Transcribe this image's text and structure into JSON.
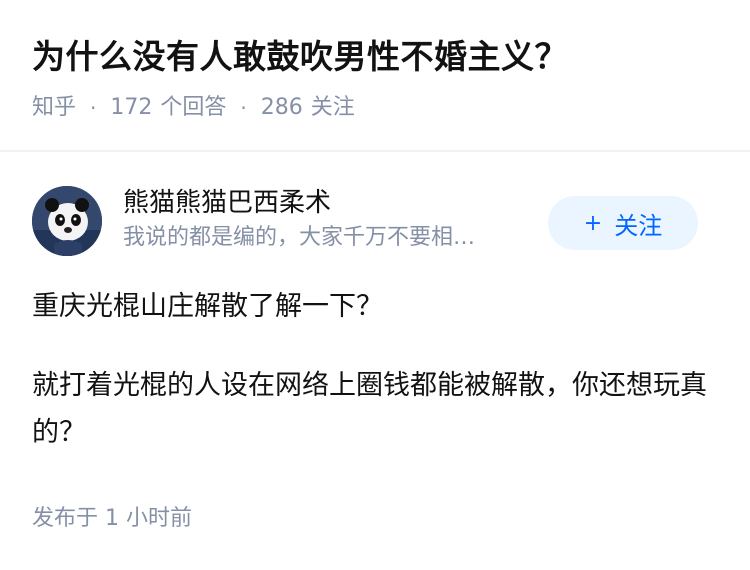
{
  "question": {
    "title": "为什么没有人敢鼓吹男性不婚主义？",
    "source": "知乎",
    "answer_count": "172",
    "answer_label": "个回答",
    "follower_count": "286",
    "follower_label": "关注"
  },
  "author": {
    "name": "熊猫熊猫巴西柔术",
    "bio": "我说的都是编的，大家千万不要相…",
    "follow_button_label": "关注",
    "follow_button_icon": "plus-icon"
  },
  "answer": {
    "paragraphs": [
      "重庆光棍山庄解散了解一下？",
      "就打着光棍的人设在网络上圈钱都能被解散，你还想玩真的？"
    ],
    "publish_time": "发布于 1 小时前"
  },
  "colors": {
    "primary_text": "#121212",
    "secondary_text": "#8590a6",
    "accent": "#0066ff",
    "accent_bg": "#ebf5ff"
  }
}
